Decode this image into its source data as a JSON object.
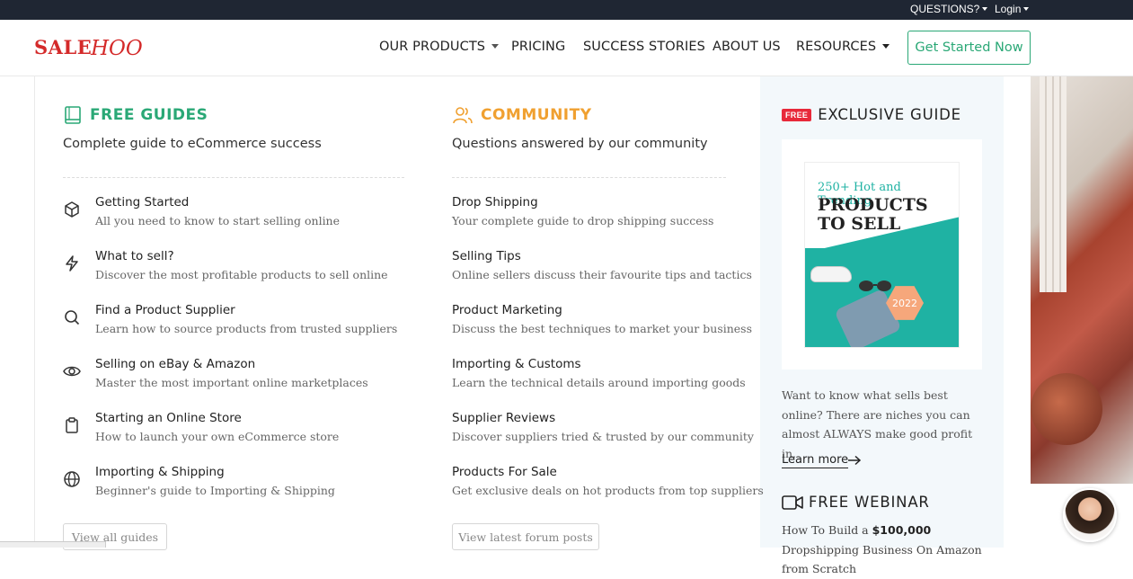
{
  "topbar": {
    "questions": "QUESTIONS?",
    "login": "Login"
  },
  "logo": {
    "text": "SALEHOO",
    "color": "#d42a2a"
  },
  "nav": {
    "items": [
      "OUR PRODUCTS",
      "PRICING",
      "SUCCESS STORIES",
      "ABOUT US",
      "RESOURCES"
    ],
    "cta": "Get Started Now"
  },
  "guides": {
    "heading": "FREE GUIDES",
    "subheading": "Complete guide to eCommerce success",
    "items": [
      {
        "title": "Getting Started",
        "desc": "All you need to know to start selling online",
        "icon": "box-icon"
      },
      {
        "title": "What to sell?",
        "desc": "Discover the most profitable products to sell online",
        "icon": "lightning-icon"
      },
      {
        "title": "Find a Product Supplier",
        "desc": "Learn how to source products from trusted suppliers",
        "icon": "search-icon"
      },
      {
        "title": "Selling on eBay & Amazon",
        "desc": "Master the most important online marketplaces",
        "icon": "eye-icon"
      },
      {
        "title": "Starting an Online Store",
        "desc": "How to launch your own eCommerce store",
        "icon": "clipboard-icon"
      },
      {
        "title": "Importing & Shipping",
        "desc": "Beginner's guide to Importing & Shipping",
        "icon": "globe-icon"
      }
    ],
    "button": "View all guides"
  },
  "community": {
    "heading": "COMMUNITY",
    "subheading": "Questions answered by our community",
    "items": [
      {
        "title": "Drop Shipping",
        "desc": "Your complete guide to drop shipping success"
      },
      {
        "title": "Selling Tips",
        "desc": "Online sellers discuss their favourite tips and tactics"
      },
      {
        "title": "Product Marketing",
        "desc": "Discuss the best techniques to market your business"
      },
      {
        "title": "Importing & Customs",
        "desc": "Learn the technical details around importing goods"
      },
      {
        "title": "Supplier Reviews",
        "desc": "Discover suppliers tried & trusted by our community"
      },
      {
        "title": "Products For Sale",
        "desc": "Get exclusive deals on hot products from top suppliers"
      }
    ],
    "button": "View latest forum posts"
  },
  "exclusive": {
    "badge": "FREE",
    "heading": "EXCLUSIVE GUIDE",
    "cover_line1": "250+ Hot and Trending",
    "cover_line2": "PRODUCTS TO SELL",
    "cover_year": "2022",
    "text": "Want to know what sells best online? There are niches you can almost ALWAYS make good profit in.",
    "learn_more": "Learn more"
  },
  "webinar": {
    "heading": "FREE WEBINAR",
    "text_pre": "How To Build a ",
    "text_bold": "$100,000",
    "text_post": " Dropshipping Business On Amazon from Scratch"
  },
  "colors": {
    "green": "#2aa876",
    "orange": "#f0a030",
    "red_badge": "#e8293a",
    "topbar": "#1f2633"
  }
}
